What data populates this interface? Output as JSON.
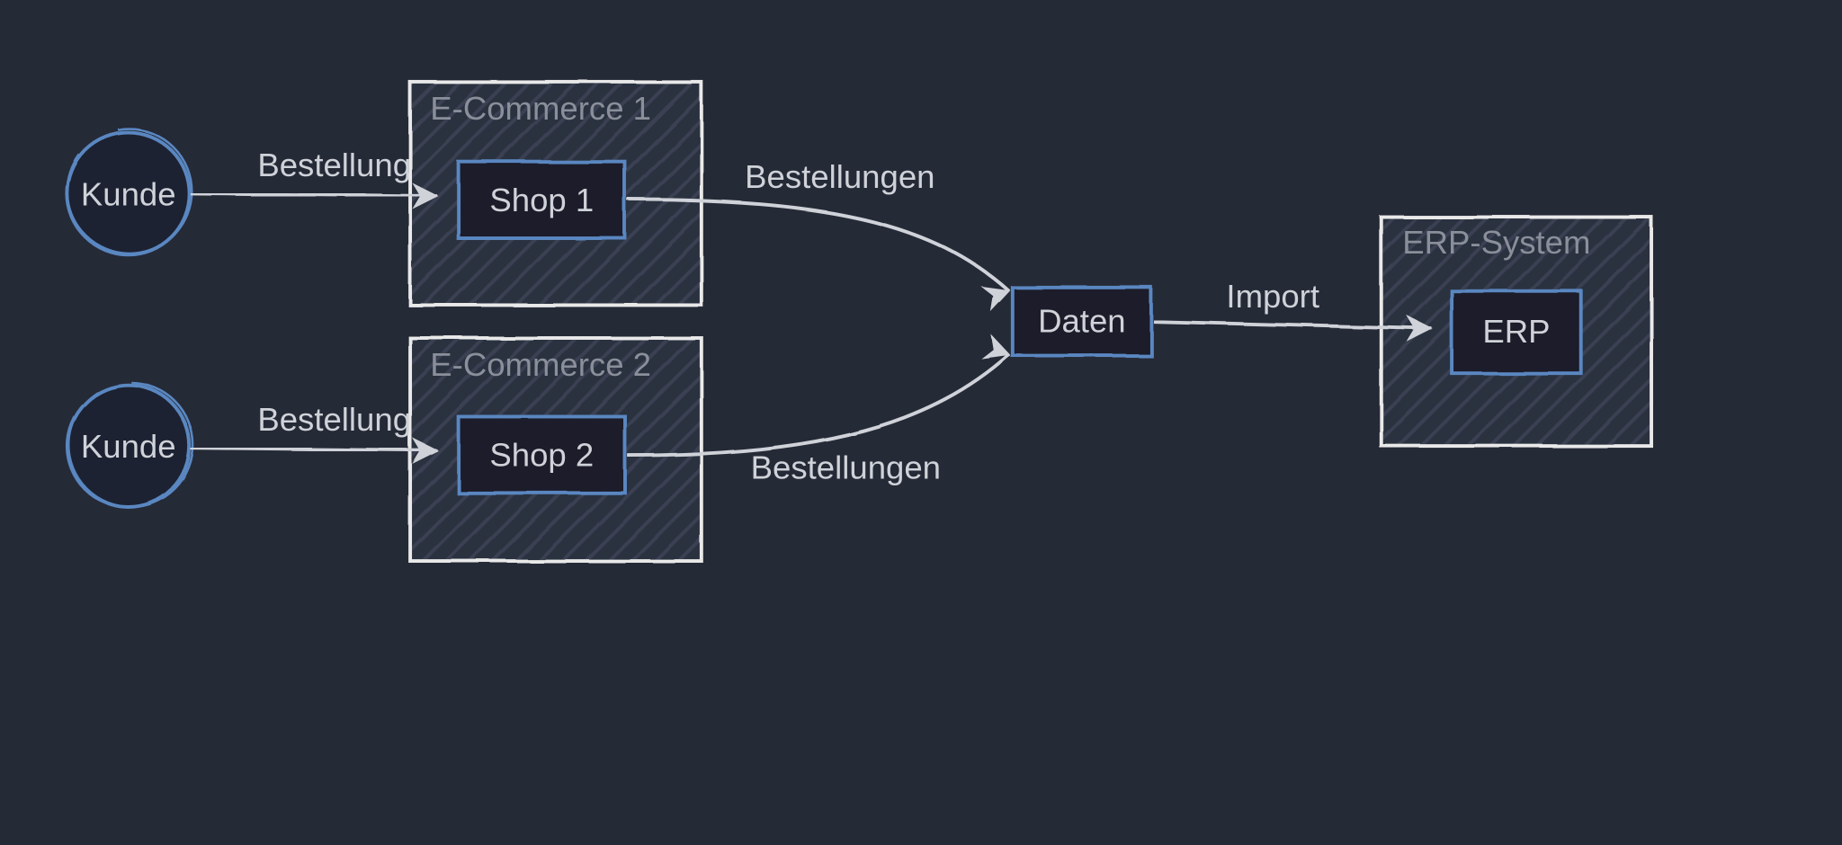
{
  "nodes": {
    "kunde1": "Kunde",
    "kunde2": "Kunde",
    "ec1_title": "E-Commerce 1",
    "ec2_title": "E-Commerce 2",
    "shop1": "Shop 1",
    "shop2": "Shop 2",
    "daten": "Daten",
    "erp_title": "ERP-System",
    "erp": "ERP"
  },
  "edges": {
    "best1": "Bestellung",
    "best2": "Bestellung",
    "bests1": "Bestellungen",
    "bests2": "Bestellungen",
    "import": "Import"
  }
}
